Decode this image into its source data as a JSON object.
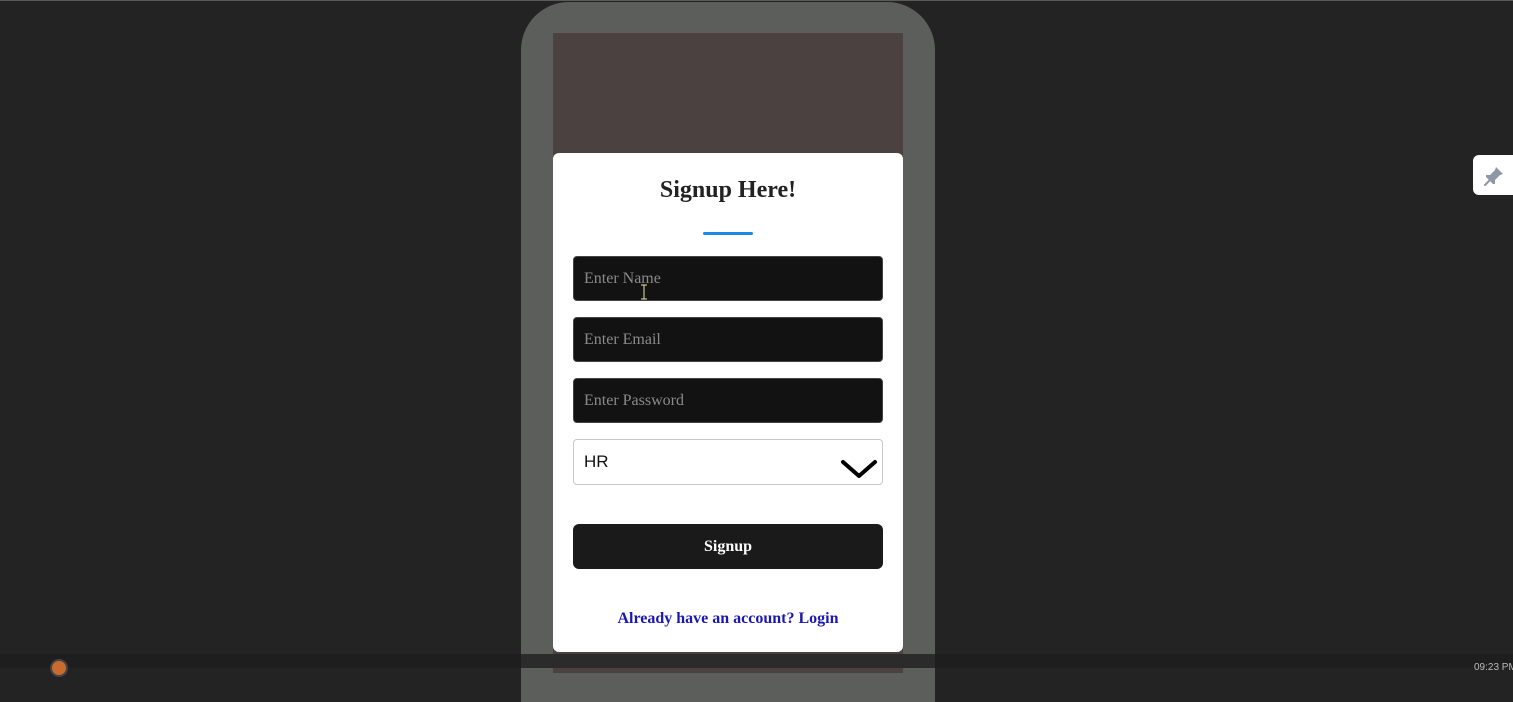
{
  "form": {
    "title": "Signup Here!",
    "name_placeholder": "Enter Name",
    "email_placeholder": "Enter Email",
    "password_placeholder": "Enter Password",
    "role_selected": "HR",
    "signup_label": "Signup",
    "login_text": "Already have an account? Login"
  },
  "colors": {
    "accent": "#1a8ae5",
    "button_bg": "#1a1a1a",
    "link": "#1b17b3",
    "page_bg": "#232323",
    "phone_frame": "#5c5e5b",
    "phone_screen": "#4b4141"
  },
  "icons": {
    "dropdown": "chevron-down-icon",
    "side_tab": "pin-icon",
    "cursor": "text-cursor-icon"
  },
  "taskbar": {
    "clock": "09:23 PM"
  }
}
